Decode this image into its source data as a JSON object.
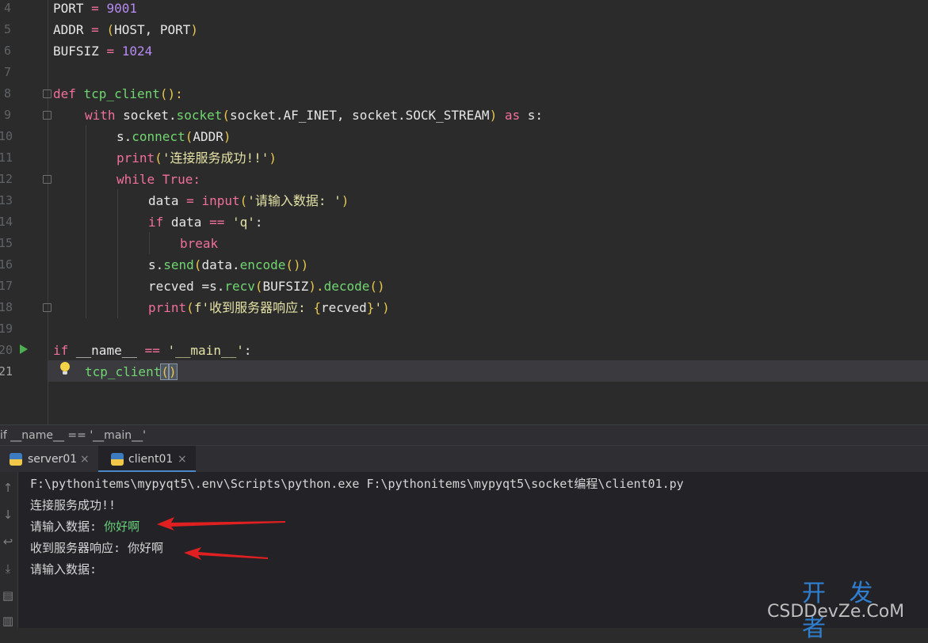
{
  "editor": {
    "line_numbers": [
      "4",
      "5",
      "6",
      "7",
      "8",
      "9",
      "10",
      "11",
      "12",
      "13",
      "14",
      "15",
      "16",
      "17",
      "18",
      "19",
      "20",
      "21"
    ],
    "lines": {
      "l4": [
        "PORT ",
        "= ",
        "9001"
      ],
      "l5": [
        "ADDR ",
        "= ",
        "(",
        "HOST, PORT",
        ")"
      ],
      "l6": [
        "BUFSIZ ",
        "= ",
        "1024"
      ],
      "l8": [
        "def ",
        "tcp_client",
        "():"
      ],
      "l9": [
        "with ",
        "socket.",
        "socket",
        "(",
        "socket.AF_INET, socket.SOCK_STREAM",
        ") ",
        "as ",
        "s:"
      ],
      "l10": [
        "s.",
        "connect",
        "(",
        "ADDR",
        ")"
      ],
      "l11": [
        "print",
        "(",
        "'连接服务成功!!'",
        ")"
      ],
      "l12": [
        "while ",
        "True:"
      ],
      "l13": [
        "data ",
        "= ",
        "input",
        "(",
        "'请输入数据: '",
        ")"
      ],
      "l14": [
        "if ",
        "data ",
        "== ",
        "'q'",
        ":"
      ],
      "l15": [
        "break"
      ],
      "l16": [
        "s.",
        "send",
        "(",
        "data.",
        "encode",
        "()",
        ")"
      ],
      "l17": [
        "recved ",
        "=s.",
        "recv",
        "(",
        "BUFSIZ",
        ").",
        "decode",
        "()"
      ],
      "l18": [
        "print",
        "(",
        "f'收到服务器响应: ",
        "{",
        "recved",
        "}",
        "'",
        ")"
      ],
      "l20": [
        "if ",
        "__name__ ",
        "== ",
        "'__main__'",
        ":"
      ],
      "l21": [
        "tcp_client",
        "(",
        ")"
      ]
    }
  },
  "breadcrumb": "if __name__ == '__main__'",
  "run_tabs": [
    {
      "label": "server01",
      "close": "×"
    },
    {
      "label": "client01",
      "close": "×"
    }
  ],
  "console": {
    "lines": [
      "F:\\pythonitems\\mypyqt5\\.env\\Scripts\\python.exe F:\\pythonitems\\mypyqt5\\socket编程\\client01.py",
      "连接服务成功!!",
      "请输入数据: ",
      "收到服务器响应: 你好啊",
      "请输入数据: "
    ],
    "user_input": "你好啊"
  },
  "watermark": {
    "big": "开 发 者",
    "small": "CSDDevZe.CoM"
  },
  "colors": {
    "keyword": "#f1709a",
    "number": "#b68bf1",
    "function": "#71d671",
    "paren": "#e7c74d",
    "string": "#e4e2a5",
    "console_input": "#67d37a",
    "annotation_arrow": "#e02020"
  }
}
